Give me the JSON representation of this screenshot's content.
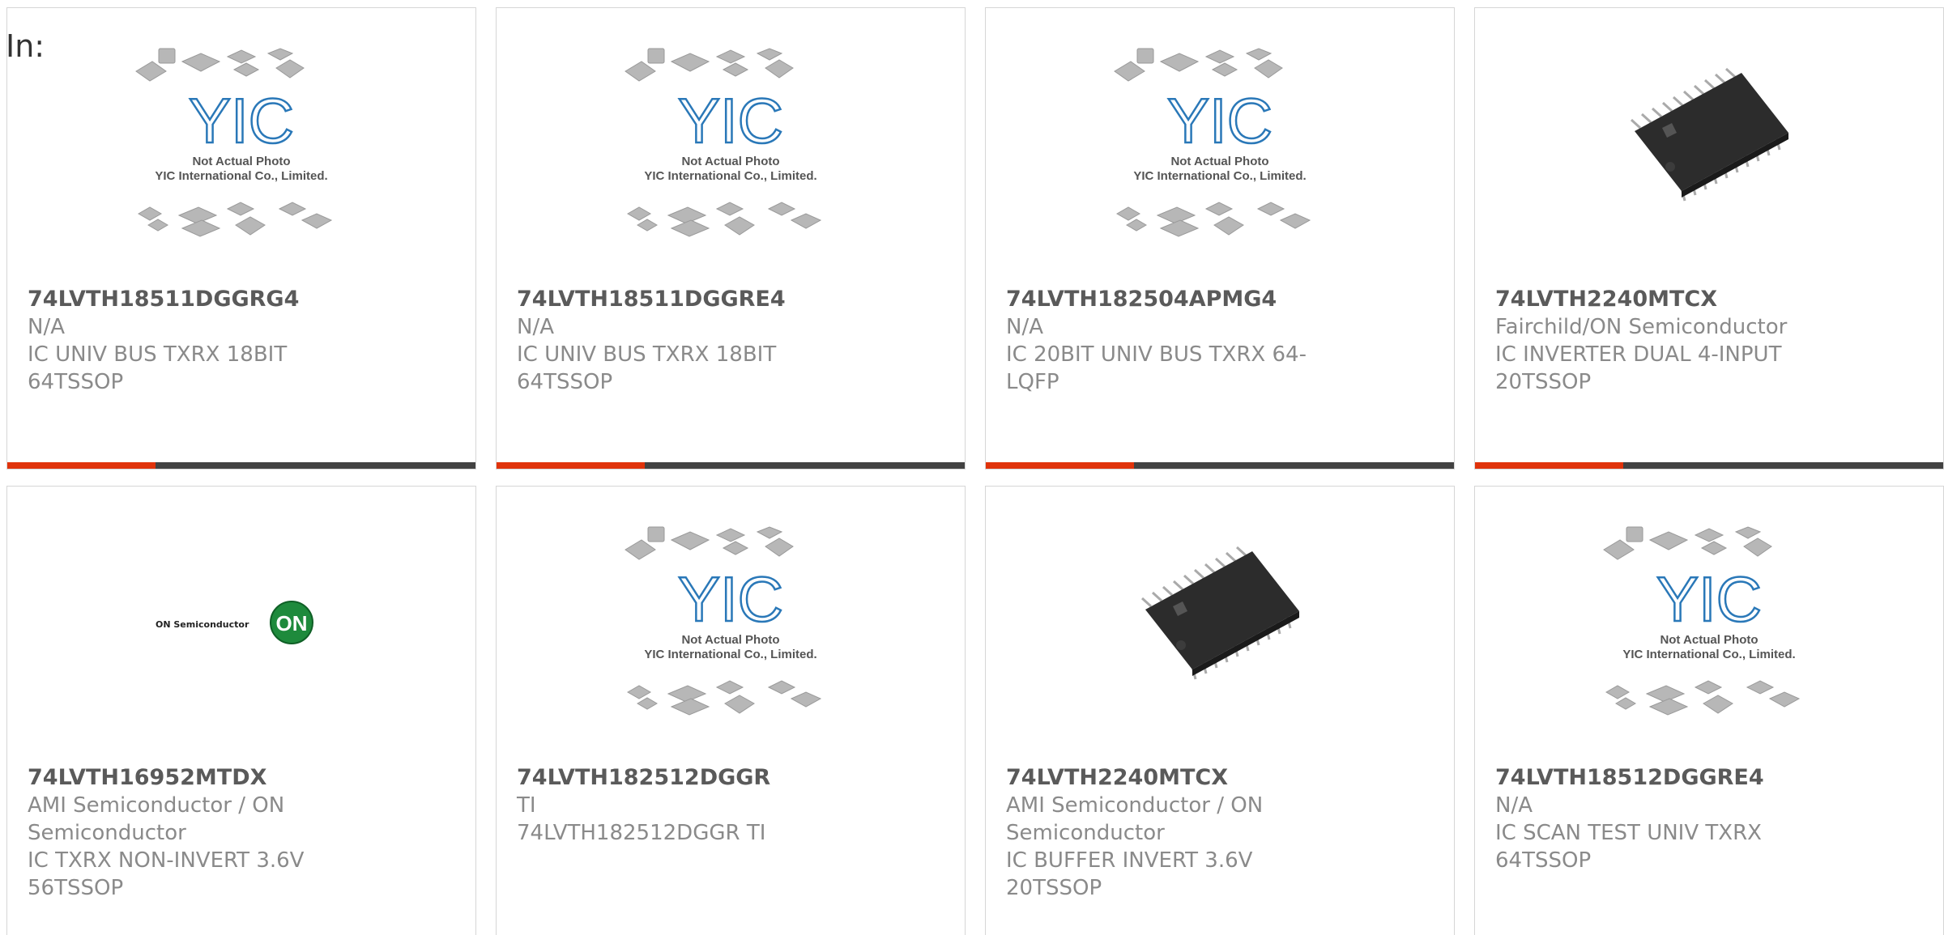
{
  "header": {
    "label": "In:"
  },
  "placeholder": {
    "line1": "Not Actual Photo",
    "line2": "YIC International Co., Limited."
  },
  "brand": {
    "on_semi": "ON Semiconductor"
  },
  "colors": {
    "accent": "#e0330b",
    "bar": "#424242"
  },
  "products": [
    {
      "part": "74LVTH18511DGGRG4",
      "maker": "N/A",
      "desc1": "IC UNIV BUS TXRX 18BIT",
      "desc2": "64TSSOP",
      "image": "yic-placeholder"
    },
    {
      "part": "74LVTH18511DGGRE4",
      "maker": "N/A",
      "desc1": "IC UNIV BUS TXRX 18BIT",
      "desc2": "64TSSOP",
      "image": "yic-placeholder"
    },
    {
      "part": "74LVTH182504APMG4",
      "maker": "N/A",
      "desc1": "IC 20BIT UNIV BUS TXRX 64-",
      "desc2": "LQFP",
      "image": "yic-placeholder"
    },
    {
      "part": "74LVTH2240MTCX",
      "maker": "Fairchild/ON Semiconductor",
      "desc1": "IC INVERTER DUAL 4-INPUT",
      "desc2": "20TSSOP",
      "image": "tssop-chip"
    },
    {
      "part": "74LVTH16952MTDX",
      "maker": "AMI Semiconductor / ON",
      "desc1": "Semiconductor",
      "desc2": "IC TXRX NON-INVERT 3.6V",
      "desc3": "56TSSOP",
      "image": "on-semi-logo"
    },
    {
      "part": "74LVTH182512DGGR",
      "maker": "TI",
      "desc1": "74LVTH182512DGGR TI",
      "desc2": "",
      "image": "yic-placeholder"
    },
    {
      "part": "74LVTH2240MTCX",
      "maker": "AMI Semiconductor / ON",
      "desc1": "Semiconductor",
      "desc2": "IC BUFFER INVERT 3.6V",
      "desc3": "20TSSOP",
      "image": "tssop-chip"
    },
    {
      "part": "74LVTH18512DGGRE4",
      "maker": "N/A",
      "desc1": "IC SCAN TEST UNIV TXRX",
      "desc2": "64TSSOP",
      "image": "yic-placeholder"
    }
  ]
}
